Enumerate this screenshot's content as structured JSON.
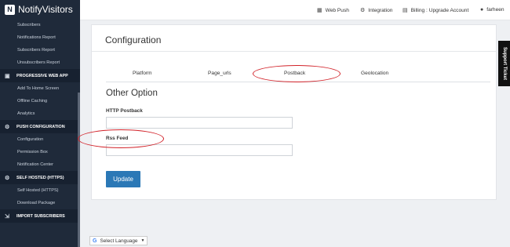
{
  "brand": {
    "name": "NotifyVisitors"
  },
  "sidebar": {
    "items": [
      {
        "type": "item",
        "label": "Subscribers"
      },
      {
        "type": "item",
        "label": "Notifications Report"
      },
      {
        "type": "item",
        "label": "Subscribers Report"
      },
      {
        "type": "item",
        "label": "Unsubscribers Report"
      },
      {
        "type": "section",
        "label": "PROGRESSIVE WEB APP",
        "icon": "pwa-icon"
      },
      {
        "type": "item",
        "label": "Add To Home Screen"
      },
      {
        "type": "item",
        "label": "Offline Caching"
      },
      {
        "type": "item",
        "label": "Analytics"
      },
      {
        "type": "section",
        "label": "PUSH CONFIGURATION",
        "icon": "gear-icon"
      },
      {
        "type": "item",
        "label": "Configuration"
      },
      {
        "type": "item",
        "label": "Permission Box"
      },
      {
        "type": "item",
        "label": "Notification Center"
      },
      {
        "type": "section",
        "label": "SELF HOSTED (HTTPS)",
        "icon": "gear-icon"
      },
      {
        "type": "item",
        "label": "Self Hosted (HTTPS)"
      },
      {
        "type": "item",
        "label": "Download Package"
      },
      {
        "type": "section",
        "label": "IMPORT SUBSCRIBERS",
        "icon": "import-icon"
      }
    ]
  },
  "topbar": {
    "web_push": "Web Push",
    "integration": "Integration",
    "billing": "Billing : Upgrade Account",
    "user": "farheen"
  },
  "main": {
    "title": "Configuration",
    "tabs": [
      {
        "label": "Platform"
      },
      {
        "label": "Page_urls"
      },
      {
        "label": "Postback"
      },
      {
        "label": "Geolocation"
      }
    ],
    "active_tab": "Postback",
    "section_heading": "Other Option",
    "fields": {
      "http_postback": {
        "label": "HTTP Postback",
        "value": "",
        "placeholder": ""
      },
      "rss_feed": {
        "label": "Rss Feed",
        "value": "",
        "placeholder": ""
      }
    },
    "update_label": "Update"
  },
  "support_ticket": "Support Ticket",
  "language": {
    "label": "Select Language"
  },
  "colors": {
    "sidebar_bg": "#1f2a3a",
    "primary_button": "#2b78b6",
    "annotation": "#d2232a"
  }
}
